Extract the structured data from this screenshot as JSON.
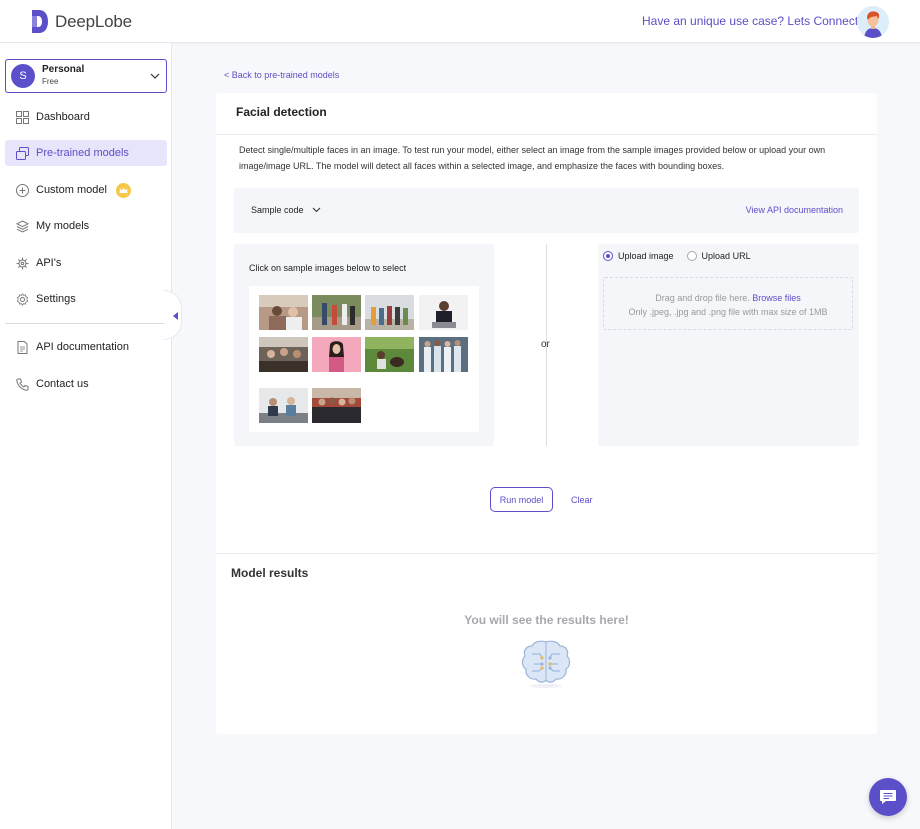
{
  "header": {
    "logo_text": "DeepLobe",
    "connect_text": "Have an unique use case? Lets Connect",
    "brand_color": "#5b50c9"
  },
  "account": {
    "initial": "S",
    "name": "Personal",
    "plan": "Free"
  },
  "sidebar": {
    "items": [
      {
        "label": "Dashboard",
        "icon": "grid-icon",
        "active": false
      },
      {
        "label": "Pre-trained models",
        "icon": "layers-icon",
        "active": true
      },
      {
        "label": "Custom model",
        "icon": "plus-circle-icon",
        "active": false,
        "badge": "crown-icon"
      },
      {
        "label": "My models",
        "icon": "stack-icon",
        "active": false
      },
      {
        "label": "API's",
        "icon": "api-gear-icon",
        "active": false
      },
      {
        "label": "Settings",
        "icon": "gear-icon",
        "active": false
      }
    ],
    "secondary": [
      {
        "label": "API documentation",
        "icon": "document-icon"
      },
      {
        "label": "Contact us",
        "icon": "phone-icon"
      }
    ]
  },
  "main": {
    "back_link": "< Back to pre-trained models",
    "title": "Facial detection",
    "description": "Detect single/multiple faces in an image. To test run your model, either select an image from the sample images provided below or upload your own image/image URL. The model will detect all faces within a selected image, and emphasize the faces with bounding boxes.",
    "sample_code_label": "Sample code",
    "api_doc_label": "View API documentation",
    "sample_images_label": "Click on sample images below to select",
    "sample_images_count": 10,
    "or_label": "or",
    "upload_options": [
      {
        "label": "Upload image",
        "selected": true
      },
      {
        "label": "Upload URL",
        "selected": false
      }
    ],
    "dropzone": {
      "line1_prefix": "Drag and drop file here.",
      "browse_label": "Browse files",
      "line2": "Only .jpeg, .jpg and .png file with max size of 1MB"
    },
    "run_button": "Run model",
    "clear_button": "Clear",
    "results_title": "Model results",
    "results_placeholder": "You will see the results here!"
  }
}
